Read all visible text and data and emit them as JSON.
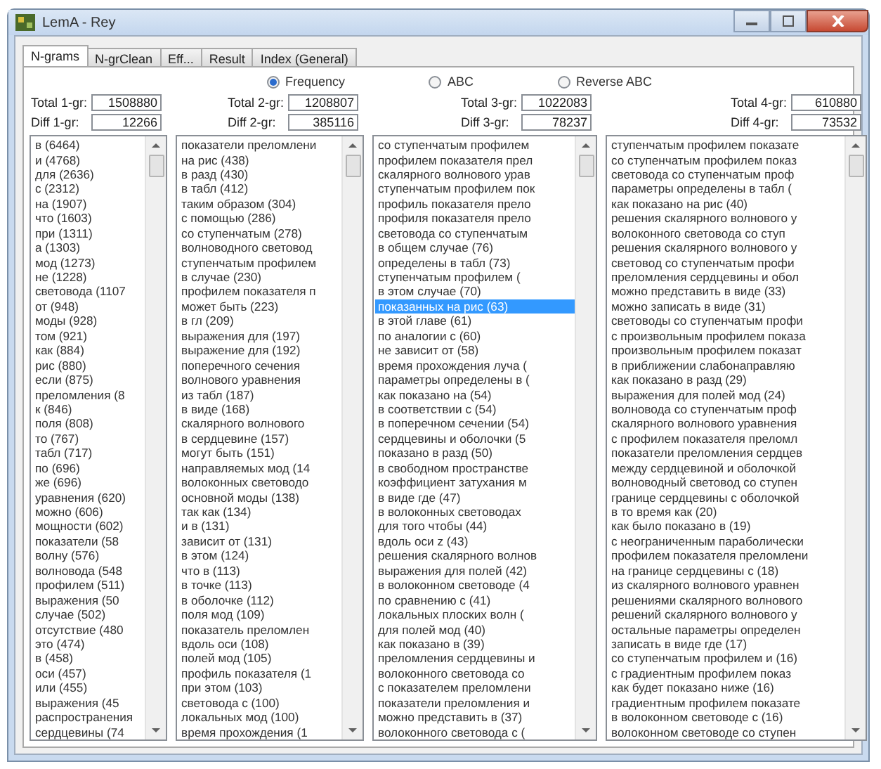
{
  "window": {
    "title": "LemA - Rey"
  },
  "tabs": [
    {
      "label": "N-grams",
      "selected": true
    },
    {
      "label": "N-grClean",
      "selected": false
    },
    {
      "label": "Eff...",
      "selected": false
    },
    {
      "label": "Result",
      "selected": false
    },
    {
      "label": "Index (General)",
      "selected": false
    }
  ],
  "sort_options": [
    {
      "label": "Frequency",
      "selected": true
    },
    {
      "label": "ABC",
      "selected": false
    },
    {
      "label": "Reverse ABC",
      "selected": false
    }
  ],
  "columns": [
    {
      "total_label": "Total 1-gr:",
      "total": "1508880",
      "diff_label": "Diff 1-gr:",
      "diff": "12266",
      "items": [
        {
          "text": "в (6464)",
          "selected": false
        },
        {
          "text": "и (4768)",
          "selected": false
        },
        {
          "text": "для (2636)",
          "selected": false
        },
        {
          "text": "с (2312)",
          "selected": false
        },
        {
          "text": "на (1907)",
          "selected": false
        },
        {
          "text": "что (1603)",
          "selected": false
        },
        {
          "text": "при (1311)",
          "selected": false
        },
        {
          "text": "а (1303)",
          "selected": false
        },
        {
          "text": "мод (1273)",
          "selected": false
        },
        {
          "text": "не (1228)",
          "selected": false
        },
        {
          "text": "световода (1107",
          "selected": false
        },
        {
          "text": "от (948)",
          "selected": false
        },
        {
          "text": "моды (928)",
          "selected": false
        },
        {
          "text": "том (921)",
          "selected": false
        },
        {
          "text": "как (884)",
          "selected": false
        },
        {
          "text": "рис (880)",
          "selected": false
        },
        {
          "text": "если (875)",
          "selected": false
        },
        {
          "text": "преломления (8",
          "selected": false
        },
        {
          "text": "к (846)",
          "selected": false
        },
        {
          "text": "поля (808)",
          "selected": false
        },
        {
          "text": "то (767)",
          "selected": false
        },
        {
          "text": "табл (717)",
          "selected": false
        },
        {
          "text": "по (696)",
          "selected": false
        },
        {
          "text": "же (696)",
          "selected": false
        },
        {
          "text": "уравнения (620)",
          "selected": false
        },
        {
          "text": "можно (606)",
          "selected": false
        },
        {
          "text": "мощности (602)",
          "selected": false
        },
        {
          "text": "показатели (58",
          "selected": false
        },
        {
          "text": "волну (576)",
          "selected": false
        },
        {
          "text": "волновода (548",
          "selected": false
        },
        {
          "text": "профилем (511)",
          "selected": false
        },
        {
          "text": "выражения (50",
          "selected": false
        },
        {
          "text": "случае (502)",
          "selected": false
        },
        {
          "text": "отсутствие (480",
          "selected": false
        },
        {
          "text": "это (474)",
          "selected": false
        },
        {
          "text": "в (458)",
          "selected": false
        },
        {
          "text": "оси (457)",
          "selected": false
        },
        {
          "text": "или (455)",
          "selected": false
        },
        {
          "text": "выражения (45",
          "selected": false
        },
        {
          "text": "распространения",
          "selected": false
        },
        {
          "text": "сердцевины (74",
          "selected": false
        }
      ]
    },
    {
      "total_label": "Total 2-gr:",
      "total": "1208807",
      "diff_label": "Diff 2-gr:",
      "diff": "385116",
      "items": [
        {
          "text": "показатели преломлени",
          "selected": false
        },
        {
          "text": "на рис (438)",
          "selected": false
        },
        {
          "text": "в разд (430)",
          "selected": false
        },
        {
          "text": "в табл (412)",
          "selected": false
        },
        {
          "text": "таким образом (304)",
          "selected": false
        },
        {
          "text": "с помощью (286)",
          "selected": false
        },
        {
          "text": "со ступенчатым (278)",
          "selected": false
        },
        {
          "text": "волноводного световод",
          "selected": false
        },
        {
          "text": "ступенчатым профилем",
          "selected": false
        },
        {
          "text": "в случае (230)",
          "selected": false
        },
        {
          "text": "профилем показателя п",
          "selected": false
        },
        {
          "text": "может быть (223)",
          "selected": false
        },
        {
          "text": "в гл (209)",
          "selected": false
        },
        {
          "text": "выражения для (197)",
          "selected": false
        },
        {
          "text": "выражение для (192)",
          "selected": false
        },
        {
          "text": "поперечного сечения",
          "selected": false
        },
        {
          "text": "волнового уравнения",
          "selected": false
        },
        {
          "text": "из табл (187)",
          "selected": false
        },
        {
          "text": "в виде (168)",
          "selected": false
        },
        {
          "text": "скалярного волнового",
          "selected": false
        },
        {
          "text": "в сердцевине (157)",
          "selected": false
        },
        {
          "text": "могут быть (151)",
          "selected": false
        },
        {
          "text": "направляемых мод (14",
          "selected": false
        },
        {
          "text": "волоконных световодо",
          "selected": false
        },
        {
          "text": "основной моды (138)",
          "selected": false
        },
        {
          "text": "так как (134)",
          "selected": false
        },
        {
          "text": "и в (131)",
          "selected": false
        },
        {
          "text": "зависит от (131)",
          "selected": false
        },
        {
          "text": "в этом (124)",
          "selected": false
        },
        {
          "text": "что в (113)",
          "selected": false
        },
        {
          "text": "в точке (113)",
          "selected": false
        },
        {
          "text": "в оболочке (112)",
          "selected": false
        },
        {
          "text": "поля мод (109)",
          "selected": false
        },
        {
          "text": "показатель преломлен",
          "selected": false
        },
        {
          "text": "вдоль оси (108)",
          "selected": false
        },
        {
          "text": "полей мод (105)",
          "selected": false
        },
        {
          "text": "профиль показателя (1",
          "selected": false
        },
        {
          "text": "при этом (103)",
          "selected": false
        },
        {
          "text": "световода с (100)",
          "selected": false
        },
        {
          "text": "локальных мод (100)",
          "selected": false
        },
        {
          "text": "время прохождения (1",
          "selected": false
        }
      ]
    },
    {
      "total_label": "Total 3-gr:",
      "total": "1022083",
      "diff_label": "Diff 3-gr:",
      "diff": "78237",
      "items": [
        {
          "text": "со ступенчатым профилем",
          "selected": false
        },
        {
          "text": "профилем показателя прел",
          "selected": false
        },
        {
          "text": "скалярного волнового урав",
          "selected": false
        },
        {
          "text": "ступенчатым профилем пок",
          "selected": false
        },
        {
          "text": "профиль показателя прело",
          "selected": false
        },
        {
          "text": "профиля показателя прело",
          "selected": false
        },
        {
          "text": "световода со ступенчатым",
          "selected": false
        },
        {
          "text": "в общем случае (76)",
          "selected": false
        },
        {
          "text": "определены в табл (73)",
          "selected": false
        },
        {
          "text": "ступенчатым профилем (",
          "selected": false
        },
        {
          "text": "в этом случае (70)",
          "selected": false
        },
        {
          "text": "показанных на рис (63)",
          "selected": true
        },
        {
          "text": "в этой главе (61)",
          "selected": false
        },
        {
          "text": "по аналогии с (60)",
          "selected": false
        },
        {
          "text": "не зависит от (58)",
          "selected": false
        },
        {
          "text": "время прохождения луча (",
          "selected": false
        },
        {
          "text": "параметры определены в (",
          "selected": false
        },
        {
          "text": "как показано на (54)",
          "selected": false
        },
        {
          "text": "в соответствии с (54)",
          "selected": false
        },
        {
          "text": "в поперечном сечении (54)",
          "selected": false
        },
        {
          "text": "сердцевины и оболочки (5",
          "selected": false
        },
        {
          "text": "показано в разд (50)",
          "selected": false
        },
        {
          "text": "в свободном пространстве",
          "selected": false
        },
        {
          "text": "коэффициент затухания м",
          "selected": false
        },
        {
          "text": "в виде где (47)",
          "selected": false
        },
        {
          "text": "в волоконных световодах",
          "selected": false
        },
        {
          "text": "для того чтобы (44)",
          "selected": false
        },
        {
          "text": "вдоль оси z (43)",
          "selected": false
        },
        {
          "text": "решения скалярного волнов",
          "selected": false
        },
        {
          "text": "выражения для полей (42)",
          "selected": false
        },
        {
          "text": "в волоконном световоде (4",
          "selected": false
        },
        {
          "text": "по сравнению с (41)",
          "selected": false
        },
        {
          "text": "локальных плоских волн (",
          "selected": false
        },
        {
          "text": "для полей мод (40)",
          "selected": false
        },
        {
          "text": "как показано в (39)",
          "selected": false
        },
        {
          "text": "преломления сердцевины и",
          "selected": false
        },
        {
          "text": "волоконного световода со",
          "selected": false
        },
        {
          "text": "с показателем преломлени",
          "selected": false
        },
        {
          "text": "показатели преломления и",
          "selected": false
        },
        {
          "text": "можно представить в (37)",
          "selected": false
        },
        {
          "text": "волоконного световода с (",
          "selected": false
        }
      ]
    },
    {
      "total_label": "Total 4-gr:",
      "total": "610880",
      "diff_label": "Diff 4-gr:",
      "diff": "73532",
      "items": [
        {
          "text": "ступенчатым профилем показате",
          "selected": false
        },
        {
          "text": "со ступенчатым профилем показ",
          "selected": false
        },
        {
          "text": "световода со ступенчатым проф",
          "selected": false
        },
        {
          "text": "параметры определены в табл (",
          "selected": false
        },
        {
          "text": "как показано на рис (40)",
          "selected": false
        },
        {
          "text": "решения скалярного волнового у",
          "selected": false
        },
        {
          "text": "волоконного световода со ступ",
          "selected": false
        },
        {
          "text": "решения скалярного волнового у",
          "selected": false
        },
        {
          "text": "световод со ступенчатым профи",
          "selected": false
        },
        {
          "text": "преломления сердцевины и обол",
          "selected": false
        },
        {
          "text": "можно представить в виде (33)",
          "selected": false
        },
        {
          "text": "можно записать в виде (31)",
          "selected": false
        },
        {
          "text": "световоды со ступенчатым профи",
          "selected": false
        },
        {
          "text": "с произвольным профилем показа",
          "selected": false
        },
        {
          "text": "произвольным профилем показат",
          "selected": false
        },
        {
          "text": "в приближении слабонаправляю",
          "selected": false
        },
        {
          "text": "как показано в разд (29)",
          "selected": false
        },
        {
          "text": "выражения для полей мод (24)",
          "selected": false
        },
        {
          "text": "волновода со ступенчатым проф",
          "selected": false
        },
        {
          "text": "скалярного волнового уравнения",
          "selected": false
        },
        {
          "text": "с профилем показателя преломл",
          "selected": false
        },
        {
          "text": "показатели преломления сердцев",
          "selected": false
        },
        {
          "text": "между сердцевиной и оболочкой",
          "selected": false
        },
        {
          "text": "волноводный световод со ступен",
          "selected": false
        },
        {
          "text": "границе сердцевины с оболочкой",
          "selected": false
        },
        {
          "text": "в то время как (20)",
          "selected": false
        },
        {
          "text": "как было показано в (19)",
          "selected": false
        },
        {
          "text": "с неограниченным параболически",
          "selected": false
        },
        {
          "text": "профилем показателя преломлени",
          "selected": false
        },
        {
          "text": "на границе сердцевины с (18)",
          "selected": false
        },
        {
          "text": "из скалярного волнового уравнен",
          "selected": false
        },
        {
          "text": "решениями скалярного волнового",
          "selected": false
        },
        {
          "text": "решений скалярного волнового у",
          "selected": false
        },
        {
          "text": "остальные параметры определен",
          "selected": false
        },
        {
          "text": "записать в виде где (17)",
          "selected": false
        },
        {
          "text": "со ступенчатым профилем и (16)",
          "selected": false
        },
        {
          "text": "с градиентным профилем показ",
          "selected": false
        },
        {
          "text": "как будет показано ниже (16)",
          "selected": false
        },
        {
          "text": "градиентным профилем показате",
          "selected": false
        },
        {
          "text": "в волоконном световоде с (16)",
          "selected": false
        },
        {
          "text": "волоконном световоде со ступен",
          "selected": false
        }
      ]
    }
  ]
}
